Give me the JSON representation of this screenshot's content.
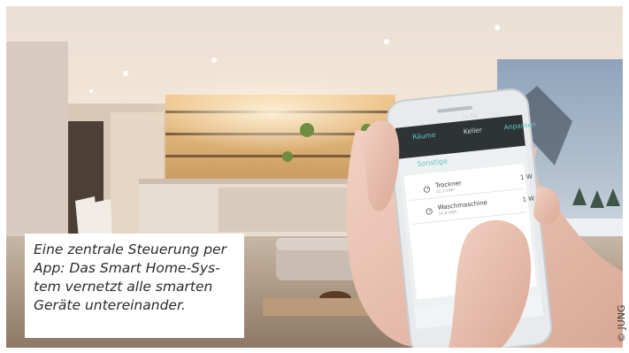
{
  "caption": {
    "lines": [
      "Eine zentrale Steuerung per",
      "App: Das Smart Home-Sys-",
      "tem vernetzt alle smarten",
      "Geräte untereinander."
    ]
  },
  "credit": "© JUNG",
  "phone": {
    "status_time": "11:54",
    "back_label": "Räume",
    "screen_title": "Keller",
    "edit_label": "Anpassen",
    "section_title": "Sonstige",
    "devices": [
      {
        "name": "Trockner",
        "sub": "12,1 kWh",
        "value": "1 W",
        "icon": "plug-gauge-icon"
      },
      {
        "name": "Waschmaschine",
        "sub": "10,8 kWh",
        "value": "1 W",
        "icon": "plug-gauge-icon"
      }
    ]
  },
  "colors": {
    "accent": "#63c6c6",
    "caption_bg": "#ffffff",
    "caption_text": "#2b2b2b"
  }
}
